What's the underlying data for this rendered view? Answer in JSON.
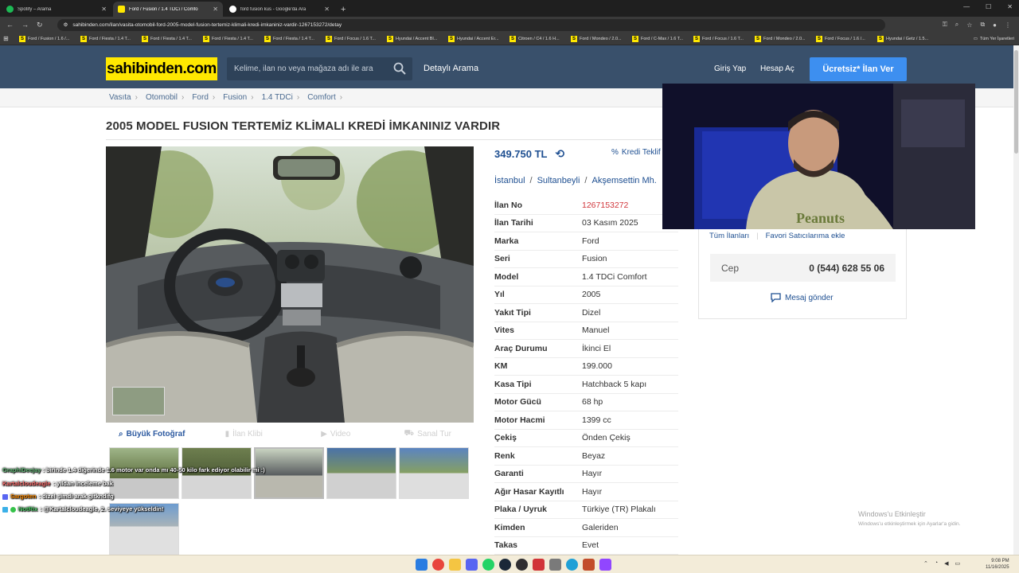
{
  "browser": {
    "tabs": [
      {
        "title": "Spotify – Arama",
        "color": "#1db954"
      },
      {
        "title": "Ford / Fusion / 1.4 TDCi / Comfo",
        "color": "#ffe800"
      },
      {
        "title": "ford fusion kus - Google'da Ara",
        "color": "#ffffff"
      }
    ],
    "url": "sahibinden.com/ilan/vasita-otomobil-ford-2005-model-fusion-tertemiz-klimali-kredi-imkaniniz-vardir-1267153272/detay",
    "bookmarks": [
      "Ford / Fusion / 1.6 /...",
      "Ford / Fiesta / 1.4 T...",
      "Ford / Fiesta / 1.4 T...",
      "Ford / Fiesta / 1.4 T...",
      "Ford / Fiesta / 1.4 T...",
      "Ford / Focus / 1.6 T...",
      "Hyundai / Accent Bl...",
      "Hyundai / Accent Er...",
      "Citroen / C4 / 1.6 H...",
      "Ford / Mondeo / 2.0...",
      "Ford / C-Max / 1.6 T...",
      "Ford / Focus / 1.6 T...",
      "Ford / Mondeo / 2.0...",
      "Ford / Focus / 1.6 /...",
      "Hyundai / Getz / 1.5..."
    ],
    "bookmarks_right": "Tüm Yer İşaretleri"
  },
  "header": {
    "logo": "sahibinden.com",
    "search_placeholder": "Kelime, ilan no veya mağaza adı ile ara",
    "advanced_search": "Detaylı Arama",
    "login": "Giriş Yap",
    "signup": "Hesap Aç",
    "post_ad": "Ücretsiz* İlan Ver"
  },
  "breadcrumb": [
    "Vasıta",
    "Otomobil",
    "Ford",
    "Fusion",
    "1.4 TDCi",
    "Comfort"
  ],
  "listing": {
    "title": "2005 MODEL FUSION TERTEMİZ KLİMALI KREDİ İMKANINIZ VARDIR",
    "price": "349.750 TL",
    "credit_label": "Kredi Teklif",
    "location": [
      "İstanbul",
      "Sultanbeyli",
      "Akşemsettin Mh."
    ],
    "photo_tools": [
      "Büyük Fotoğraf",
      "İlan Klibi",
      "Video",
      "Sanal Tur"
    ],
    "specs": [
      {
        "label": "İlan No",
        "value": "1267153272"
      },
      {
        "label": "İlan Tarihi",
        "value": "03 Kasım 2025"
      },
      {
        "label": "Marka",
        "value": "Ford"
      },
      {
        "label": "Seri",
        "value": "Fusion"
      },
      {
        "label": "Model",
        "value": "1.4 TDCi Comfort"
      },
      {
        "label": "Yıl",
        "value": "2005"
      },
      {
        "label": "Yakıt Tipi",
        "value": "Dizel"
      },
      {
        "label": "Vites",
        "value": "Manuel"
      },
      {
        "label": "Araç Durumu",
        "value": "İkinci El"
      },
      {
        "label": "KM",
        "value": "199.000"
      },
      {
        "label": "Kasa Tipi",
        "value": "Hatchback 5 kapı"
      },
      {
        "label": "Motor Gücü",
        "value": "68 hp"
      },
      {
        "label": "Motor Hacmi",
        "value": "1399 cc"
      },
      {
        "label": "Çekiş",
        "value": "Önden Çekiş"
      },
      {
        "label": "Renk",
        "value": "Beyaz"
      },
      {
        "label": "Garanti",
        "value": "Hayır"
      },
      {
        "label": "Ağır Hasar Kayıtlı",
        "value": "Hayır"
      },
      {
        "label": "Plaka / Uyruk",
        "value": "Türkiye (TR) Plakalı"
      },
      {
        "label": "Kimden",
        "value": "Galeriden"
      },
      {
        "label": "Takas",
        "value": "Evet"
      }
    ]
  },
  "seller": {
    "all_listings": "Tüm İlanları",
    "favorite": "Favori Satıcılarıma ekle",
    "phone_label": "Cep",
    "phone": "0 (544) 628 55 06",
    "message": "Mesaj gönder"
  },
  "chat": [
    {
      "user": "GraphiDeejay",
      "text": ": birinde 1.4 diğerinde 1.6 motor var onda mı 40-50 kilo fark ediyor olabilir mi :)"
    },
    {
      "user": "Kartalcloudeagle",
      "text": ": yıldan inceleme bak"
    },
    {
      "user": "Sargoten",
      "text": ": dizel şimdi arak gitkndifg"
    },
    {
      "user": "NotRix",
      "text": ": @Kartalcloudeagle, 2. seviyeye yükseldin!"
    }
  ],
  "watermark": {
    "line1": "Windows'u Etkinleştir",
    "line2": "Windows'u etkinleştirmek için Ayarlar'a gidin."
  },
  "clock": {
    "time": "9:08 PM",
    "date": "11/16/2025"
  },
  "colors": {
    "header_bg": "#39506b",
    "logo_bg": "#ffe800",
    "accent_blue": "#3d8ff0",
    "link_blue": "#1e4f91",
    "ad_no_red": "#d1373c"
  }
}
